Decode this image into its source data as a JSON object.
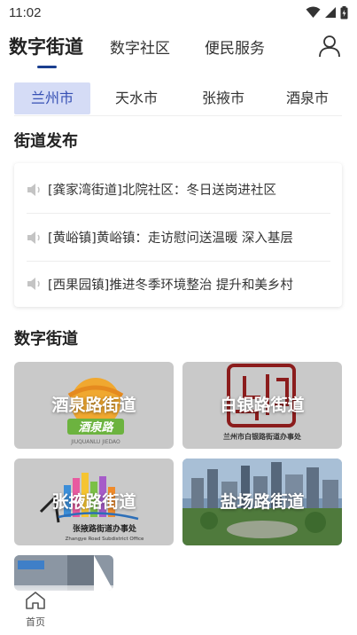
{
  "status_bar": {
    "time": "11:02"
  },
  "top_tabs": [
    {
      "label": "数字街道",
      "active": true
    },
    {
      "label": "数字社区",
      "active": false
    },
    {
      "label": "便民服务",
      "active": false
    }
  ],
  "cities": [
    {
      "label": "兰州市",
      "active": true
    },
    {
      "label": "天水市",
      "active": false
    },
    {
      "label": "张掖市",
      "active": false
    },
    {
      "label": "酒泉市",
      "active": false
    }
  ],
  "news_section": {
    "title": "街道发布",
    "items": [
      "[龚家湾街道]北院社区：冬日送岗进社区",
      "[黄峪镇]黄峪镇：走访慰问送温暖 深入基层",
      "[西果园镇]推进冬季环境整治 提升和美乡村"
    ]
  },
  "digital_section": {
    "title": "数字街道",
    "cards": [
      {
        "label": "酒泉路街道",
        "sub": "JIUQUANLU JIEDAO",
        "logo_text": "酒泉路"
      },
      {
        "label": "白银路街道",
        "sub": "兰州市白银路街道办事处"
      },
      {
        "label": "张掖路街道",
        "sub": "张掖路街道办事处",
        "sub_en": "Zhangye Road Subdistrict Office"
      },
      {
        "label": "盐场路街道"
      }
    ]
  },
  "bottom_nav": {
    "home_label": "首页"
  },
  "colors": {
    "accent": "#1a3f8f",
    "city_active_bg": "#d5dcf6",
    "city_active_text": "#3650b4"
  }
}
